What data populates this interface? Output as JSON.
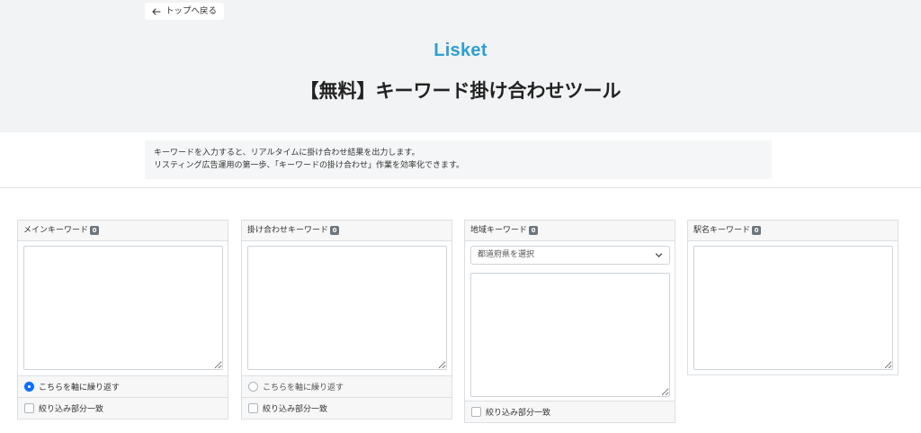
{
  "header": {
    "back_label": "トップへ戻る",
    "logo": "Lisket",
    "title": "【無料】キーワード掛け合わせツール"
  },
  "description": {
    "line1": "キーワードを入力すると、リアルタイムに掛け合わせ結果を出力します。",
    "line2": "リスティング広告運用の第一歩、「キーワードの掛け合わせ」作業を効率化できます。"
  },
  "panels": [
    {
      "title": "メインキーワード",
      "count": "0",
      "radio_label": "こちらを軸に繰り返す",
      "radio_checked": true,
      "checkbox_label": "絞り込み部分一致"
    },
    {
      "title": "掛け合わせキーワード",
      "count": "0",
      "radio_label": "こちらを軸に繰り返す",
      "radio_checked": false,
      "checkbox_label": "絞り込み部分一致"
    },
    {
      "title": "地域キーワード",
      "count": "0",
      "select_value": "都道府県を選択",
      "checkbox_label": "絞り込み部分一致"
    },
    {
      "title": "駅名キーワード",
      "count": "0"
    }
  ],
  "colors": {
    "accent": "#0d6efd",
    "logo": "#2e9fd0",
    "hero_bg": "#f2f3f4"
  }
}
